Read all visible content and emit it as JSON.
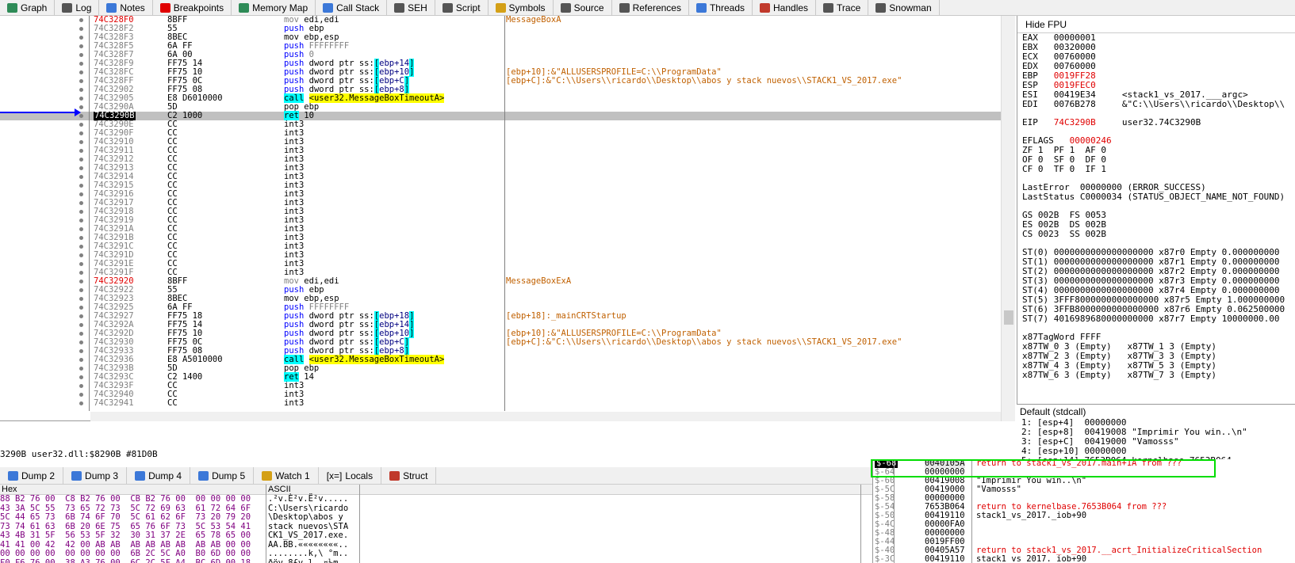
{
  "toolbar": {
    "tabs": [
      {
        "label": "Graph",
        "color": "#2e8b57"
      },
      {
        "label": "Log",
        "color": "#555555"
      },
      {
        "label": "Notes",
        "color": "#3c78d8"
      },
      {
        "label": "Breakpoints",
        "color": "#e00000"
      },
      {
        "label": "Memory Map",
        "color": "#2e8b57"
      },
      {
        "label": "Call Stack",
        "color": "#3c78d8"
      },
      {
        "label": "SEH",
        "color": "#555555"
      },
      {
        "label": "Script",
        "color": "#555555"
      },
      {
        "label": "Symbols",
        "color": "#d4a017"
      },
      {
        "label": "Source",
        "color": "#555555"
      },
      {
        "label": "References",
        "color": "#555555"
      },
      {
        "label": "Threads",
        "color": "#3c78d8"
      },
      {
        "label": "Handles",
        "color": "#c0392b"
      },
      {
        "label": "Trace",
        "color": "#555555"
      },
      {
        "label": "Snowman",
        "color": "#555555"
      }
    ]
  },
  "cpu": {
    "rows": [
      {
        "addr": "74C328F0",
        "red": true,
        "bytes": "8BFF",
        "m": "mov",
        "ops": " edi,edi",
        "cmt": "MessageBoxA"
      },
      {
        "addr": "74C328F2",
        "bytes": "55",
        "m": "push",
        "ops": " ebp"
      },
      {
        "addr": "74C328F3",
        "bytes": "8BEC",
        "m": "mov",
        "ops": " ebp,esp",
        "dark": true
      },
      {
        "addr": "74C328F5",
        "bytes": "6A FF",
        "m": "push",
        "ops": " FFFFFFFF",
        "imm": true
      },
      {
        "addr": "74C328F7",
        "bytes": "6A 00",
        "m": "push",
        "ops": " 0",
        "imm": true
      },
      {
        "addr": "74C328F9",
        "bytes": "FF75 14",
        "m": "push",
        "ptr": "ebp+14"
      },
      {
        "addr": "74C328FC",
        "bytes": "FF75 10",
        "m": "push",
        "ptr": "ebp+10",
        "cmt": "[ebp+10]:&\"ALLUSERSPROFILE=C:\\\\ProgramData\""
      },
      {
        "addr": "74C328FF",
        "bytes": "FF75 0C",
        "m": "push",
        "ptr": "ebp+C",
        "cmt": "[ebp+C]:&\"C:\\\\Users\\\\ricardo\\\\Desktop\\\\abos y stack nuevos\\\\STACK1_VS_2017.exe\""
      },
      {
        "addr": "74C32902",
        "bytes": "FF75 08",
        "m": "push",
        "ptr": "ebp+8"
      },
      {
        "addr": "74C32905",
        "bytes": "E8 D6010000",
        "m": "call",
        "tgt": "<user32.MessageBoxTimeoutA>"
      },
      {
        "addr": "74C3290A",
        "bytes": "5D",
        "m": "pop",
        "ops": " ebp"
      },
      {
        "addr": "74C3290B",
        "sel": true,
        "bytes": "C2 1000",
        "m": "ret",
        "ops": " 10",
        "cur": true
      },
      {
        "addr": "74C3290E",
        "bytes": "CC",
        "m": "int3"
      },
      {
        "addr": "74C3290F",
        "bytes": "CC",
        "m": "int3"
      },
      {
        "addr": "74C32910",
        "bytes": "CC",
        "m": "int3"
      },
      {
        "addr": "74C32911",
        "bytes": "CC",
        "m": "int3"
      },
      {
        "addr": "74C32912",
        "bytes": "CC",
        "m": "int3"
      },
      {
        "addr": "74C32913",
        "bytes": "CC",
        "m": "int3"
      },
      {
        "addr": "74C32914",
        "bytes": "CC",
        "m": "int3"
      },
      {
        "addr": "74C32915",
        "bytes": "CC",
        "m": "int3"
      },
      {
        "addr": "74C32916",
        "bytes": "CC",
        "m": "int3"
      },
      {
        "addr": "74C32917",
        "bytes": "CC",
        "m": "int3"
      },
      {
        "addr": "74C32918",
        "bytes": "CC",
        "m": "int3"
      },
      {
        "addr": "74C32919",
        "bytes": "CC",
        "m": "int3"
      },
      {
        "addr": "74C3291A",
        "bytes": "CC",
        "m": "int3"
      },
      {
        "addr": "74C3291B",
        "bytes": "CC",
        "m": "int3"
      },
      {
        "addr": "74C3291C",
        "bytes": "CC",
        "m": "int3"
      },
      {
        "addr": "74C3291D",
        "bytes": "CC",
        "m": "int3"
      },
      {
        "addr": "74C3291E",
        "bytes": "CC",
        "m": "int3"
      },
      {
        "addr": "74C3291F",
        "bytes": "CC",
        "m": "int3"
      },
      {
        "addr": "74C32920",
        "red": true,
        "bytes": "8BFF",
        "m": "mov",
        "ops": " edi,edi",
        "cmt": "MessageBoxExA"
      },
      {
        "addr": "74C32922",
        "bytes": "55",
        "m": "push",
        "ops": " ebp"
      },
      {
        "addr": "74C32923",
        "bytes": "8BEC",
        "m": "mov",
        "ops": " ebp,esp",
        "dark": true
      },
      {
        "addr": "74C32925",
        "bytes": "6A FF",
        "m": "push",
        "ops": " FFFFFFFF",
        "imm": true
      },
      {
        "addr": "74C32927",
        "bytes": "FF75 18",
        "m": "push",
        "ptr": "ebp+18",
        "cmt": "[ebp+18]:_mainCRTStartup"
      },
      {
        "addr": "74C3292A",
        "bytes": "FF75 14",
        "m": "push",
        "ptr": "ebp+14"
      },
      {
        "addr": "74C3292D",
        "bytes": "FF75 10",
        "m": "push",
        "ptr": "ebp+10",
        "cmt": "[ebp+10]:&\"ALLUSERSPROFILE=C:\\\\ProgramData\""
      },
      {
        "addr": "74C32930",
        "bytes": "FF75 0C",
        "m": "push",
        "ptr": "ebp+C",
        "cmt": "[ebp+C]:&\"C:\\\\Users\\\\ricardo\\\\Desktop\\\\abos y stack nuevos\\\\STACK1_VS_2017.exe\""
      },
      {
        "addr": "74C32933",
        "bytes": "FF75 08",
        "m": "push",
        "ptr": "ebp+8"
      },
      {
        "addr": "74C32936",
        "bytes": "E8 A5010000",
        "m": "call",
        "tgt": "<user32.MessageBoxTimeoutA>"
      },
      {
        "addr": "74C3293B",
        "bytes": "5D",
        "m": "pop",
        "ops": " ebp"
      },
      {
        "addr": "74C3293C",
        "bytes": "C2 1400",
        "m": "ret",
        "ops": " 14"
      },
      {
        "addr": "74C3293F",
        "bytes": "CC",
        "m": "int3"
      },
      {
        "addr": "74C32940",
        "bytes": "CC",
        "m": "int3"
      },
      {
        "addr": "74C32941",
        "bytes": "CC",
        "m": "int3"
      }
    ]
  },
  "regs": {
    "header": "Hide FPU",
    "lines": [
      {
        "t": "EAX   00000001"
      },
      {
        "t": "EBX   00320000"
      },
      {
        "t": "ECX   00760000"
      },
      {
        "t": "EDX   00760000"
      },
      {
        "t": "EBP   ",
        "v": "0019FF28",
        "red": true
      },
      {
        "t": "ESP   ",
        "v": "0019FEC0",
        "red": true
      },
      {
        "t": "ESI   00419E34     <stack1_vs_2017.___argc>"
      },
      {
        "t": "EDI   0076B278     &\"C:\\\\Users\\\\ricardo\\\\Desktop\\\\"
      },
      {
        "t": ""
      },
      {
        "t": "EIP   ",
        "v": "74C3290B",
        "red": true,
        "tail": "     user32.74C3290B"
      },
      {
        "t": ""
      },
      {
        "t": "EFLAGS   ",
        "v": "00000246",
        "red": true
      },
      {
        "t": "ZF 1  PF 1  AF 0"
      },
      {
        "t": "OF 0  SF 0  DF 0"
      },
      {
        "t": "CF 0  TF 0  IF 1"
      },
      {
        "t": ""
      },
      {
        "t": "LastError  00000000 (ERROR_SUCCESS)"
      },
      {
        "t": "LastStatus C0000034 (STATUS_OBJECT_NAME_NOT_FOUND)"
      },
      {
        "t": ""
      },
      {
        "t": "GS 002B  FS 0053"
      },
      {
        "t": "ES 002B  DS 002B"
      },
      {
        "t": "CS 0023  SS 002B"
      },
      {
        "t": ""
      },
      {
        "t": "ST(0) 0000000000000000000 x87r0 Empty 0.000000000"
      },
      {
        "t": "ST(1) 0000000000000000000 x87r1 Empty 0.000000000"
      },
      {
        "t": "ST(2) 0000000000000000000 x87r2 Empty 0.000000000"
      },
      {
        "t": "ST(3) 0000000000000000000 x87r3 Empty 0.000000000"
      },
      {
        "t": "ST(4) 0000000000000000000 x87r4 Empty 0.000000000"
      },
      {
        "t": "ST(5) 3FFF8000000000000000 x87r5 Empty 1.000000000"
      },
      {
        "t": "ST(6) 3FFB8000000000000000 x87r6 Empty 0.062500000"
      },
      {
        "t": "ST(7) 4016989680000000000 x87r7 Empty 10000000.00"
      },
      {
        "t": ""
      },
      {
        "t": "x87TagWord FFFF"
      },
      {
        "t": "x87TW_0 3 (Empty)   x87TW_1 3 (Empty)"
      },
      {
        "t": "x87TW_2 3 (Empty)   x87TW_3 3 (Empty)"
      },
      {
        "t": "x87TW_4 3 (Empty)   x87TW_5 3 (Empty)"
      },
      {
        "t": "x87TW_6 3 (Empty)   x87TW_7 3 (Empty)"
      }
    ]
  },
  "callconv": {
    "label": "Default (stdcall)",
    "args": [
      "1: [esp+4]  00000000",
      "2: [esp+8]  00419008 \"Imprimir You win..\\n\"",
      "3: [esp+C]  00419000 \"Vamosss\"",
      "4: [esp+10] 00000000",
      "5: [esp+14] 7653B064 kernelbase.7653B064"
    ]
  },
  "status_text": "3290B user32.dll:$8290B #81D0B",
  "dump_tabs": [
    {
      "label": "Dump 2",
      "color": "#3c78d8"
    },
    {
      "label": "Dump 3",
      "color": "#3c78d8"
    },
    {
      "label": "Dump 4",
      "color": "#3c78d8"
    },
    {
      "label": "Dump 5",
      "color": "#3c78d8"
    },
    {
      "label": "Watch 1",
      "color": "#d4a017"
    },
    {
      "label": "Locals",
      "glyph": "[x=]"
    },
    {
      "label": "Struct",
      "color": "#c0392b"
    }
  ],
  "dump": {
    "hex_header": "Hex",
    "ascii_header": "ASCII",
    "rows": [
      {
        "hex": "88 B2 76 00  C8 B2 76 00  CB B2 76 00  00 00 00 00",
        "ascii": ".²v.È²v.Ë²v....."
      },
      {
        "hex": "43 3A 5C 55  73 65 72 73  5C 72 69 63  61 72 64 6F",
        "ascii": "C:\\Users\\ricardo"
      },
      {
        "hex": "5C 44 65 73  6B 74 6F 70  5C 61 62 6F  73 20 79 20",
        "ascii": "\\Desktop\\abos y "
      },
      {
        "hex": "73 74 61 63  6B 20 6E 75  65 76 6F 73  5C 53 54 41",
        "ascii": "stack nuevos\\STA"
      },
      {
        "hex": "43 4B 31 5F  56 53 5F 32  30 31 37 2E  65 78 65 00",
        "ascii": "CK1_VS_2017.exe."
      },
      {
        "hex": "41 41 00 42  42 00 AB AB  AB AB AB AB  AB AB 00 00",
        "ascii": "AA.BB.««««««««.."
      },
      {
        "hex": "00 00 00 00  00 00 00 00  6B 2C 5C A0  B0 6D 00 00",
        "ascii": "........k,\\ °m.."
      },
      {
        "hex": "F0 F6 76 00  38 A3 76 00  6C 2C 5F A4  BC 6D 00 18",
        "ascii": "ðöv.8£v.l,_¤¼m.."
      }
    ]
  },
  "stack": {
    "rows": [
      {
        "off": "$-68",
        "val": "0040105A",
        "c": "return to stack1_vs_2017.main+1A from ???",
        "red": true,
        "sel": true
      },
      {
        "off": "$-64",
        "val": "00000000",
        "c": ""
      },
      {
        "off": "$-60",
        "val": "00419008",
        "c": "\"Imprimir You win..\\n\""
      },
      {
        "off": "$-5C",
        "val": "00419000",
        "c": "\"Vamosss\""
      },
      {
        "off": "$-58",
        "val": "00000000",
        "c": ""
      },
      {
        "off": "$-54",
        "val": "7653B064",
        "c": "return to kernelbase.7653B064 from ???",
        "red": true
      },
      {
        "off": "$-50",
        "val": "00419110",
        "c": "stack1_vs_2017._iob+90"
      },
      {
        "off": "$-4C",
        "val": "00000FA0",
        "c": ""
      },
      {
        "off": "$-48",
        "val": "00000000",
        "c": ""
      },
      {
        "off": "$-44",
        "val": "0019FF00",
        "c": ""
      },
      {
        "off": "$-40",
        "val": "00405A57",
        "c": "return to stack1_vs_2017.__acrt_InitializeCriticalSection",
        "red": true
      },
      {
        "off": "$-3C",
        "val": "00419110",
        "c": "stack1_vs_2017._iob+90"
      }
    ]
  },
  "colors": {
    "highlight": "#00dd00",
    "selection": "#000000",
    "cyan": "#00ffff",
    "yellow": "#ffff00",
    "arrow": "#0000ff"
  }
}
